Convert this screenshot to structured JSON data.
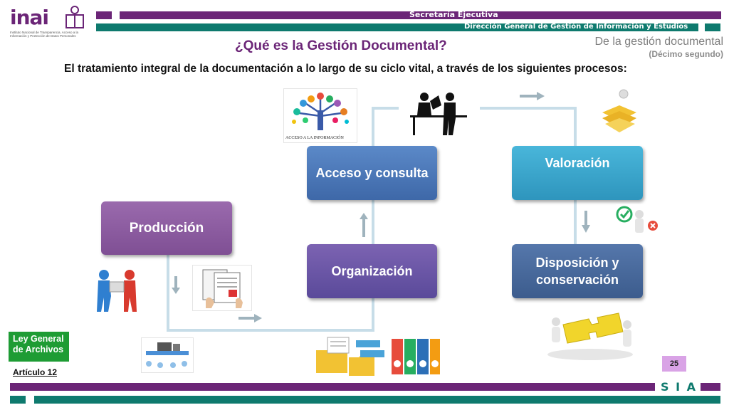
{
  "logo": {
    "wordmark": "inai",
    "tagline": "Instituto Nacional de Transparencia, Acceso a la Información y Protección de Datos Personales"
  },
  "header": {
    "secretaria": "Secretaría Ejecutiva",
    "direccion": "Dirección General de Gestión de Información y Estudios"
  },
  "title": "¿Qué es la Gestión Documental?",
  "section": {
    "name": "De la gestión documental",
    "sub": "(Décimo segundo)"
  },
  "intro": "El tratamiento integral de la documentación a lo largo de su ciclo vital, a través de los siguientes procesos:",
  "processes": {
    "produccion": "Producción",
    "organizacion": "Organización",
    "acceso": "Acceso y consulta",
    "valoracion": "Valoración",
    "disposicion": "Disposición y conservación"
  },
  "images": {
    "acceso_caption": "ACCESO A LA INFORMACIÓN"
  },
  "badge": {
    "law": "Ley General de Archivos",
    "article": "Artículo 12"
  },
  "page_number": "25",
  "footer": {
    "brand": "S I A"
  },
  "colors": {
    "purple": "#6b2577",
    "teal": "#0e7a6e",
    "produccion": "#8e5ea2",
    "acceso": "#4a78b8",
    "valoracion": "#37a6cc",
    "disposicion": "#45679a",
    "green_badge": "#1e9c34"
  }
}
